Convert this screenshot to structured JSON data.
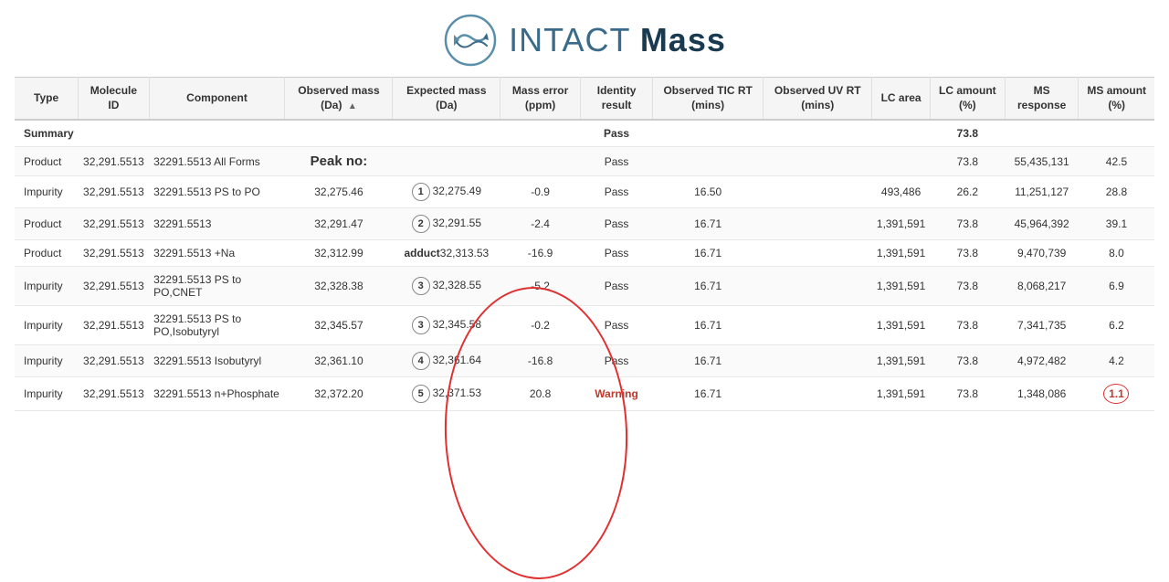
{
  "header": {
    "title_light": "INTACT",
    "title_bold": "Mass"
  },
  "table": {
    "columns": [
      "Type",
      "Molecule ID",
      "Component",
      "Observed mass (Da)",
      "Expected mass (Da)",
      "Mass error (ppm)",
      "Identity result",
      "Observed TIC RT (mins)",
      "Observed UV RT (mins)",
      "LC area",
      "LC amount (%)",
      "MS response",
      "MS amount (%)"
    ],
    "rows": [
      {
        "type": "Summary",
        "molecule_id": "",
        "component": "",
        "observed_mass": "",
        "peak_num": "",
        "expected_mass": "",
        "mass_error": "",
        "identity": "Pass",
        "tic_rt": "",
        "uv_rt": "",
        "lc_area": "",
        "lc_amount": "73.8",
        "ms_response": "",
        "ms_amount": "",
        "is_summary": true
      },
      {
        "type": "Product",
        "molecule_id": "32,291.5513",
        "component": "32291.5513 All Forms",
        "observed_mass": "",
        "peak_num": "",
        "expected_mass": "",
        "mass_error": "",
        "identity": "Pass",
        "tic_rt": "",
        "uv_rt": "",
        "lc_area": "",
        "lc_amount": "73.8",
        "ms_response": "55,435,131",
        "ms_amount": "42.5",
        "is_product_all": true
      },
      {
        "type": "Impurity",
        "molecule_id": "32,291.5513",
        "component": "32291.5513 PS to PO",
        "observed_mass": "32,275.46",
        "peak_num": "1",
        "expected_mass": "32,275.49",
        "mass_error": "-0.9",
        "identity": "Pass",
        "tic_rt": "16.50",
        "uv_rt": "",
        "lc_area": "493,486",
        "lc_amount": "26.2",
        "ms_response": "11,251,127",
        "ms_amount": "28.8"
      },
      {
        "type": "Product",
        "molecule_id": "32,291.5513",
        "component": "32291.5513",
        "observed_mass": "32,291.47",
        "peak_num": "2",
        "expected_mass": "32,291.55",
        "mass_error": "-2.4",
        "identity": "Pass",
        "tic_rt": "16.71",
        "uv_rt": "",
        "lc_area": "1,391,591",
        "lc_amount": "73.8",
        "ms_response": "45,964,392",
        "ms_amount": "39.1"
      },
      {
        "type": "Product",
        "molecule_id": "32,291.5513",
        "component": "32291.5513 +Na",
        "observed_mass": "32,312.99",
        "peak_num": "",
        "expected_mass": "32,313.53",
        "mass_error": "-16.9",
        "identity": "Pass",
        "tic_rt": "16.71",
        "uv_rt": "",
        "lc_area": "1,391,591",
        "lc_amount": "73.8",
        "ms_response": "9,470,739",
        "ms_amount": "8.0",
        "is_adduct": true,
        "adduct_label": "adduct"
      },
      {
        "type": "Impurity",
        "molecule_id": "32,291.5513",
        "component": "32291.5513 PS to PO,CNET",
        "observed_mass": "32,328.38",
        "peak_num": "3",
        "expected_mass": "32,328.55",
        "mass_error": "-5.2",
        "identity": "Pass",
        "tic_rt": "16.71",
        "uv_rt": "",
        "lc_area": "1,391,591",
        "lc_amount": "73.8",
        "ms_response": "8,068,217",
        "ms_amount": "6.9"
      },
      {
        "type": "Impurity",
        "molecule_id": "32,291.5513",
        "component": "32291.5513 PS to PO,Isobutyryl",
        "observed_mass": "32,345.57",
        "peak_num": "3",
        "expected_mass": "32,345.58",
        "mass_error": "-0.2",
        "identity": "Pass",
        "tic_rt": "16.71",
        "uv_rt": "",
        "lc_area": "1,391,591",
        "lc_amount": "73.8",
        "ms_response": "7,341,735",
        "ms_amount": "6.2"
      },
      {
        "type": "Impurity",
        "molecule_id": "32,291.5513",
        "component": "32291.5513 Isobutyryl",
        "observed_mass": "32,361.10",
        "peak_num": "4",
        "expected_mass": "32,361.64",
        "mass_error": "-16.8",
        "identity": "Pass",
        "tic_rt": "16.71",
        "uv_rt": "",
        "lc_area": "1,391,591",
        "lc_amount": "73.8",
        "ms_response": "4,972,482",
        "ms_amount": "4.2"
      },
      {
        "type": "Impurity",
        "molecule_id": "32,291.5513",
        "component": "32291.5513 n+Phosphate",
        "observed_mass": "32,372.20",
        "peak_num": "5",
        "expected_mass": "32,371.53",
        "mass_error": "20.8",
        "identity": "Warning",
        "tic_rt": "16.71",
        "uv_rt": "",
        "lc_area": "1,391,591",
        "lc_amount": "73.8",
        "ms_response": "1,348,086",
        "ms_amount": "1.1",
        "is_warning": true
      }
    ]
  },
  "annotations": {
    "peak_no_label": "Peak no:"
  }
}
